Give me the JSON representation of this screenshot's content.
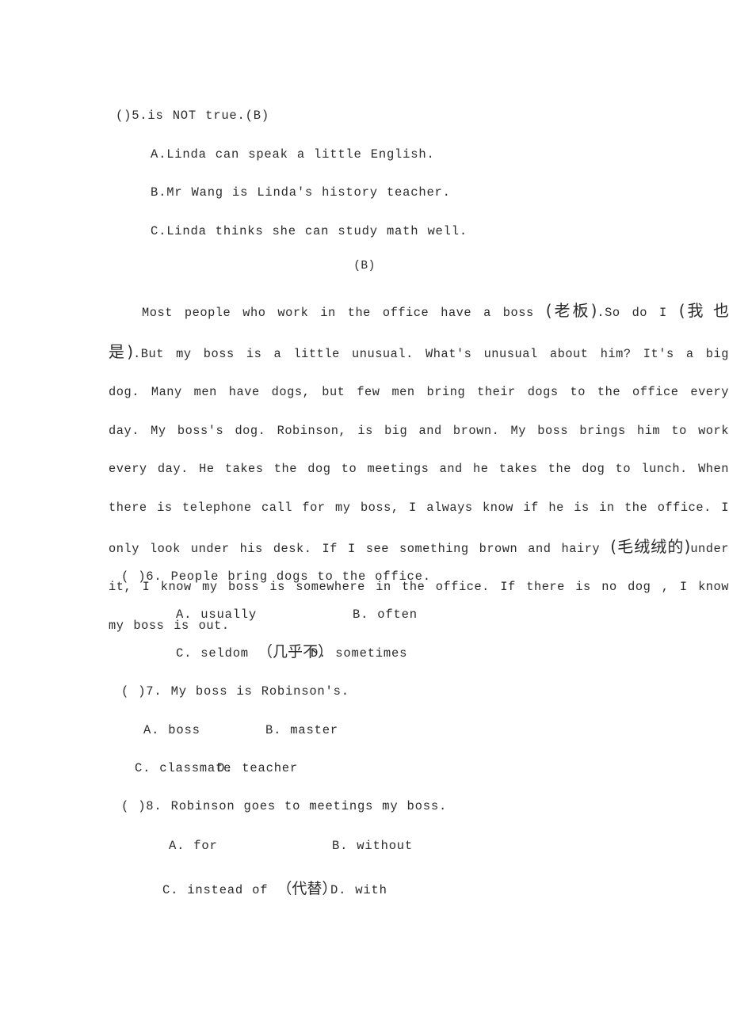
{
  "document": {
    "type": "english-reading-comprehension-worksheet",
    "language": "en-zh"
  },
  "question5": {
    "stem": "()5.is NOT true.(B)",
    "options": [
      "A.Linda can speak a little English.",
      "B.Mr Wang is Linda's history teacher.",
      "C.Linda thinks she can study math well."
    ]
  },
  "section": {
    "heading": "(B)"
  },
  "passage": {
    "segments": [
      {
        "text": "Most people who work in the office have a boss ",
        "script": "en"
      },
      {
        "text": "(老板)",
        "script": "zh"
      },
      {
        "text": ".So do I ",
        "script": "en"
      },
      {
        "text": "(我 也是)",
        "script": "zh"
      },
      {
        "text": ".But my boss is a little unusual. What's unusual about him? It's a big dog. Many men have dogs, but few men bring their dogs to the office every day. My boss's dog. Robinson, is big and brown. My boss brings him to work every day. He takes the dog to meetings and he takes the dog to lunch. When there is telephone call for my boss, I always know if he is in the office. I only look under his desk. If I see something brown and hairy ",
        "script": "en"
      },
      {
        "text": "(毛绒绒的)",
        "script": "zh"
      },
      {
        "text": "under it, I know my boss is somewhere in the office. If there is no dog , I know my boss is out.",
        "script": "en"
      }
    ],
    "full_text": "Most people who work in the office have a boss (老板).So do I (我 也是).But my boss is a little unusual. What's unusual about him? It's a big dog. Many men have dogs, but few men bring their dogs to the office every day. My boss's dog. Robinson, is big and brown. My boss brings him to work every day. He takes the dog to meetings and he takes the dog to lunch. When there is telephone call for my boss, I always know if he is in the office. I only look under his desk. If I see something brown and hairy (毛绒绒的)under it, I know my boss is somewhere in the office. If there is no dog , I know my boss is out."
  },
  "question6": {
    "stem": "( )6. People bring dogs to the office.",
    "option_a": "A. usually",
    "option_b": "B. often",
    "option_c_en": "C. seldom ",
    "option_c_cn": "（几乎不）",
    "option_d": "D. sometimes"
  },
  "question7": {
    "stem": "( )7. My boss is Robinson's.",
    "option_a": "A. boss",
    "option_b": "B. master",
    "option_c": "C. classmate",
    "option_d": "D. teacher"
  },
  "question8": {
    "stem": "( )8. Robinson goes to meetings my boss.",
    "option_a": "A. for",
    "option_b": "B. without",
    "option_c_en": "C. instead of ",
    "option_c_cn": "（代替）",
    "option_d": "D. with"
  },
  "colors": {
    "page_background": "#ffffff",
    "text": "#2b2b2b"
  }
}
